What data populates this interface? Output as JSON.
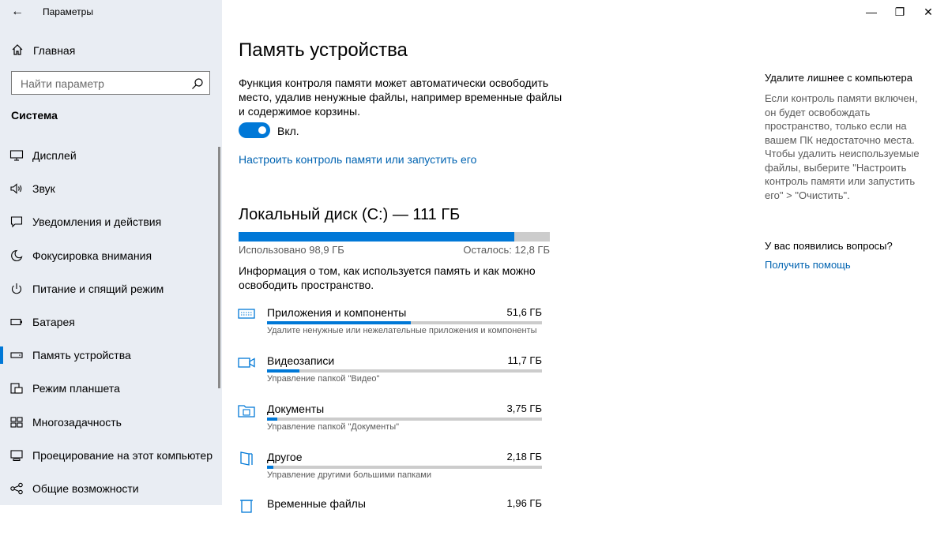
{
  "window": {
    "title": "Параметры",
    "controls": {
      "minimize": "—",
      "maximize": "❐",
      "close": "✕"
    }
  },
  "sidebar": {
    "home_label": "Главная",
    "search_placeholder": "Найти параметр",
    "section_heading": "Система",
    "items": [
      {
        "label": "Дисплей",
        "icon": "display-icon"
      },
      {
        "label": "Звук",
        "icon": "speaker-icon"
      },
      {
        "label": "Уведомления и действия",
        "icon": "notification-icon"
      },
      {
        "label": "Фокусировка внимания",
        "icon": "moon-icon"
      },
      {
        "label": "Питание и спящий режим",
        "icon": "power-icon"
      },
      {
        "label": "Батарея",
        "icon": "battery-icon"
      },
      {
        "label": "Память устройства",
        "icon": "storage-icon",
        "selected": true
      },
      {
        "label": "Режим планшета",
        "icon": "tablet-mode-icon"
      },
      {
        "label": "Многозадачность",
        "icon": "multitasking-icon"
      },
      {
        "label": "Проецирование на этот компьютер",
        "icon": "projecting-icon"
      },
      {
        "label": "Общие возможности",
        "icon": "shared-experiences-icon"
      }
    ]
  },
  "main": {
    "title": "Память устройства",
    "storage_sense_description": "Функция контроля памяти может автоматически освободить место, удалив ненужные файлы, например временные файлы и содержимое корзины.",
    "toggle": {
      "state": "on",
      "label": "Вкл."
    },
    "configure_link": "Настроить контроль памяти или запустить его",
    "disk": {
      "title": "Локальный диск (C:) — 111 ГБ",
      "used_label": "Использовано 98,9 ГБ",
      "free_label": "Осталось: 12,8 ГБ",
      "used_fraction": 0.885
    },
    "info_text": "Информация о том, как используется память и как можно освободить пространство.",
    "categories": [
      {
        "name": "Приложения и компоненты",
        "size": "51,6 ГБ",
        "description": "Удалите ненужные или нежелательные приложения и компоненты",
        "fraction": 0.523,
        "icon": "apps-icon"
      },
      {
        "name": "Видеозаписи",
        "size": "11,7 ГБ",
        "description": "Управление папкой \"Видео\"",
        "fraction": 0.118,
        "icon": "video-camera-icon"
      },
      {
        "name": "Документы",
        "size": "3,75 ГБ",
        "description": "Управление папкой \"Документы\"",
        "fraction": 0.038,
        "icon": "documents-folder-icon"
      },
      {
        "name": "Другое",
        "size": "2,18 ГБ",
        "description": "Управление другими большими папками",
        "fraction": 0.022,
        "icon": "other-folder-icon"
      },
      {
        "name": "Временные файлы",
        "size": "1,96 ГБ",
        "description": "",
        "fraction": 0.02,
        "icon": "trash-icon"
      }
    ]
  },
  "right_panel": {
    "heading": "Удалите лишнее с компьютера",
    "text": "Если контроль памяти включен, он будет освобождать пространство, только если на вашем ПК недостаточно места. Чтобы удалить неиспользуемые файлы, выберите \"Настроить контроль памяти или запустить его\" > \"Очистить\".",
    "questions_heading": "У вас появились вопросы?",
    "help_link": "Получить помощь"
  },
  "colors": {
    "accent": "#0078d7",
    "link": "#0063b1",
    "sidebar_bg": "#e9edf3",
    "bar_track": "#cccccc"
  }
}
